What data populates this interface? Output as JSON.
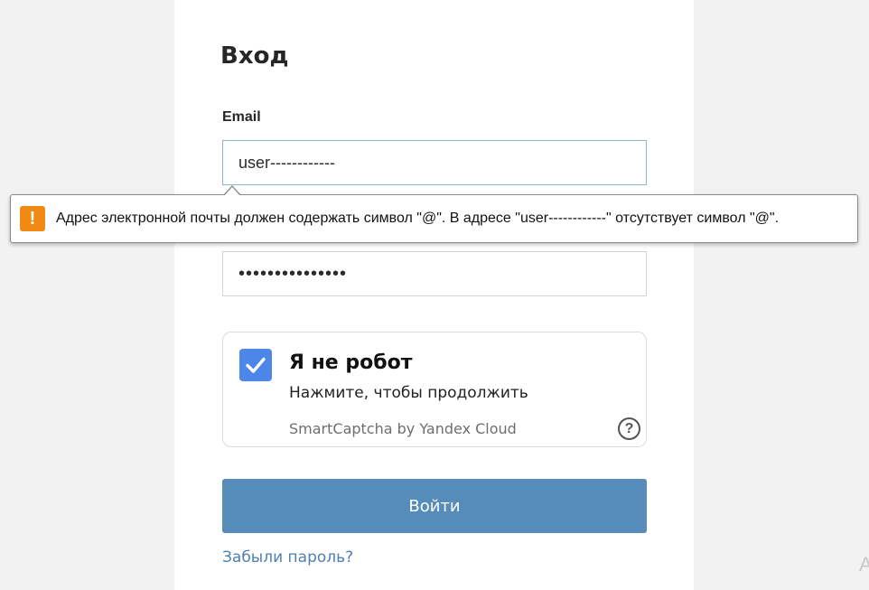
{
  "login": {
    "title": "Вход",
    "email_label": "Email",
    "email_value": "user------------",
    "password_value": "•••••••••••••••",
    "submit_label": "Войти",
    "forgot_link": "Забыли пароль?"
  },
  "captcha": {
    "title": "Я не робот",
    "subtitle": "Нажмите, чтобы продолжить",
    "brand": "SmartCaptcha by Yandex Cloud",
    "help_symbol": "?",
    "checked": true
  },
  "validation": {
    "message": "Адрес электронной почты должен содержать символ \"@\". В адресе \"user------------\" отсутствует символ \"@\".",
    "icon": "warning-icon",
    "icon_symbol": "!"
  },
  "edge": {
    "partial_char": "А"
  },
  "colors": {
    "submit_bg": "#558cba",
    "checkbox_bg": "#4c86e8",
    "warning": "#f08a14",
    "link": "#4d80b4"
  }
}
